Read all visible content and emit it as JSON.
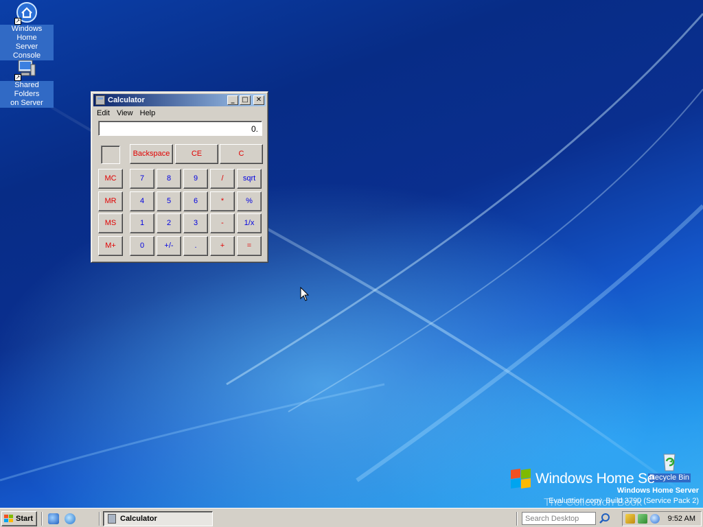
{
  "desktop": {
    "icons": [
      {
        "label_line1": "Windows Home",
        "label_line2": "Server Console",
        "icon": "home-server-console-icon"
      },
      {
        "label_line1": "Shared Folders",
        "label_line2": "on Server",
        "icon": "shared-folders-icon"
      }
    ],
    "recycle_bin": {
      "label": "Recycle Bin",
      "icon": "recycle-bin-icon"
    },
    "branding": {
      "name": "Windows Home Se",
      "edition": "Windows Home Server",
      "build": "Evaluation copy. Build 3790 (Service Pack 2)",
      "watermark": "The Collection Book"
    }
  },
  "calculator": {
    "title": "Calculator",
    "menu": [
      "Edit",
      "View",
      "Help"
    ],
    "display": "0.",
    "controls": {
      "minimize": "_",
      "maximize": "□",
      "close": "✕"
    },
    "top_row": [
      "Backspace",
      "CE",
      "C"
    ],
    "memory": [
      "MC",
      "MR",
      "MS",
      "M+"
    ],
    "rows": [
      [
        "7",
        "8",
        "9",
        "/",
        "sqrt"
      ],
      [
        "4",
        "5",
        "6",
        "*",
        "%"
      ],
      [
        "1",
        "2",
        "3",
        "-",
        "1/x"
      ],
      [
        "0",
        "+/-",
        ".",
        "+",
        "="
      ]
    ]
  },
  "taskbar": {
    "start_label": "Start",
    "task_button_label": "Calculator",
    "search_placeholder": "Search Desktop",
    "clock": "9:52 AM"
  },
  "colors": {
    "red_key": "#e00000",
    "blue_key": "#0000e0",
    "title_bar_start": "#0a246a",
    "title_bar_end": "#a6caf0",
    "selection": "#316ac5"
  }
}
